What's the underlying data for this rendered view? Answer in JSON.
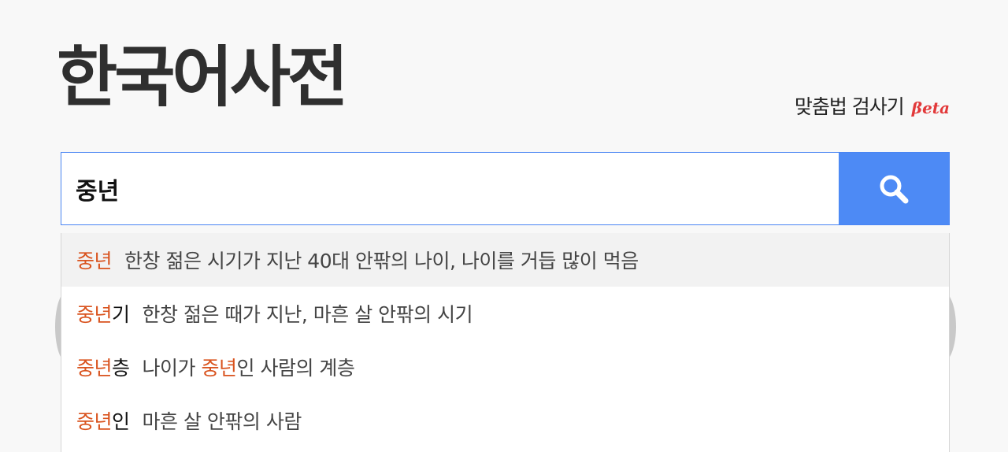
{
  "header": {
    "logo_text": "한국어사전",
    "spell_checker_label": "맞춤법 검사기",
    "beta_label": "βeta"
  },
  "search": {
    "query": "중년",
    "button_icon": "search-icon"
  },
  "suggestions": [
    {
      "match": "중년",
      "rest": "",
      "def_pre": "한창 젊은 시기가 지난 40대 안팎의 나이, 나이를 거듭 많이 먹음",
      "def_hl": "",
      "def_post": ""
    },
    {
      "match": "중년",
      "rest": "기",
      "def_pre": "한창 젊은 때가 지난, 마흔 살 안팎의 시기",
      "def_hl": "",
      "def_post": ""
    },
    {
      "match": "중년",
      "rest": "층",
      "def_pre": "나이가 ",
      "def_hl": "중년",
      "def_post": "인 사람의 계층"
    },
    {
      "match": "중년",
      "rest": "인",
      "def_pre": "마흔 살 안팎의 사람",
      "def_hl": "",
      "def_post": ""
    }
  ],
  "colors": {
    "accent_blue": "#4d8af5",
    "highlight_orange": "#d9531e",
    "beta_red": "#e2393a",
    "active_row_bg": "#f2f2f2"
  }
}
